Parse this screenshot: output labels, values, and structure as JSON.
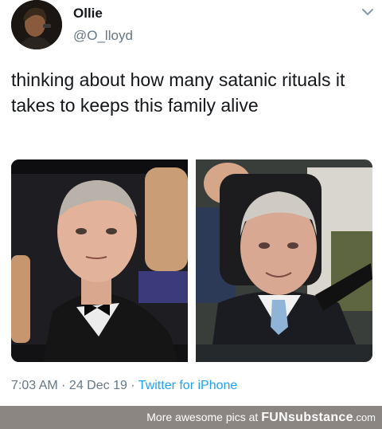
{
  "tweet": {
    "author_name": "Ollie",
    "handle": "@O_lloyd",
    "text": "thinking about how many satanic rituals it takes to keeps this family alive",
    "time": "7:03 AM",
    "separator1": " · ",
    "date": "24 Dec 19",
    "separator2": " · ",
    "source": "Twitter for iPhone",
    "icons": {
      "menu": "chevron-down-icon",
      "avatar": "avatar"
    },
    "colors": {
      "link": "#1da1f2",
      "secondary_text": "#657786"
    }
  },
  "footer": {
    "prefix": "More awesome pics at ",
    "brand_bold": "FUNsubstance",
    "brand_suffix": ".com",
    "background": "#8c8682"
  }
}
